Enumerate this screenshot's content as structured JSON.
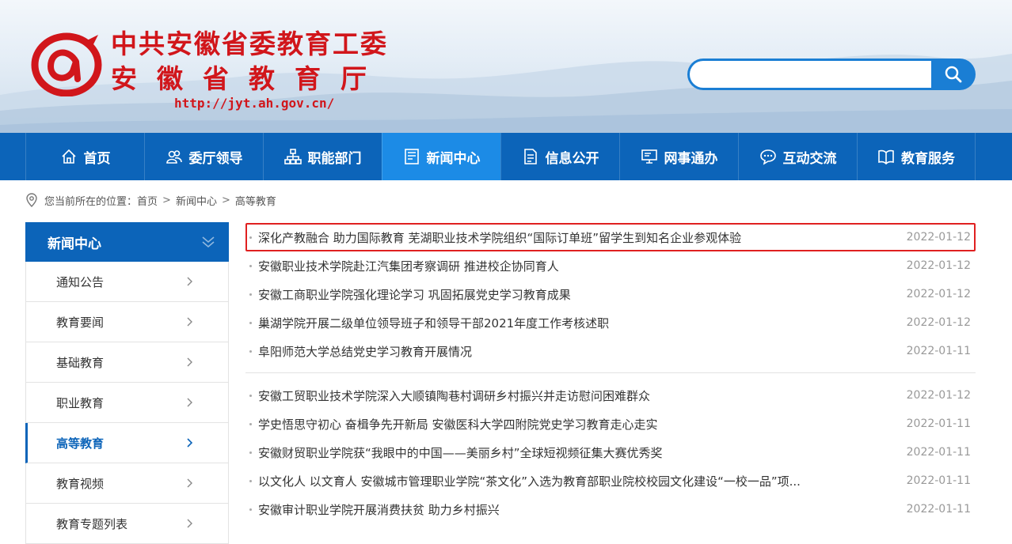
{
  "header": {
    "title_line1": "中共安徽省委教育工委",
    "title_line2": "安徽省教育厅",
    "url": "http://jyt.ah.gov.cn/",
    "brand_color": "#d1161b"
  },
  "search": {
    "placeholder": "",
    "value": "",
    "button_icon": "search-icon"
  },
  "nav": {
    "items": [
      {
        "label": "首页",
        "icon": "home-icon"
      },
      {
        "label": "委厅领导",
        "icon": "users-icon"
      },
      {
        "label": "职能部门",
        "icon": "org-chart-icon"
      },
      {
        "label": "新闻中心",
        "icon": "news-icon",
        "active": true
      },
      {
        "label": "信息公开",
        "icon": "document-icon"
      },
      {
        "label": "网事通办",
        "icon": "computer-icon"
      },
      {
        "label": "互动交流",
        "icon": "chat-icon"
      },
      {
        "label": "教育服务",
        "icon": "book-icon"
      }
    ],
    "color": "#0c64b9",
    "active_color": "#1c8be6"
  },
  "breadcrumb": {
    "prefix": "您当前所在的位置：",
    "items": [
      "首页",
      "新闻中心",
      "高等教育"
    ]
  },
  "sidebar": {
    "heading": "新闻中心",
    "items": [
      {
        "label": "通知公告"
      },
      {
        "label": "教育要闻"
      },
      {
        "label": "基础教育"
      },
      {
        "label": "职业教育"
      },
      {
        "label": "高等教育",
        "active": true
      },
      {
        "label": "教育视频"
      },
      {
        "label": "教育专题列表"
      }
    ]
  },
  "news_group_1": [
    {
      "title": "深化产教融合 助力国际教育 芜湖职业技术学院组织“国际订单班”留学生到知名企业参观体验",
      "date": "2022-01-12"
    },
    {
      "title": "安徽职业技术学院赴江汽集团考察调研 推进校企协同育人",
      "date": "2022-01-12"
    },
    {
      "title": "安徽工商职业学院强化理论学习 巩固拓展党史学习教育成果",
      "date": "2022-01-12"
    },
    {
      "title": "巢湖学院开展二级单位领导班子和领导干部2021年度工作考核述职",
      "date": "2022-01-12"
    },
    {
      "title": "阜阳师范大学总结党史学习教育开展情况",
      "date": "2022-01-11"
    }
  ],
  "news_group_2": [
    {
      "title": "安徽工贸职业技术学院深入大顺镇陶巷村调研乡村振兴并走访慰问困难群众",
      "date": "2022-01-12"
    },
    {
      "title": "学史悟思守初心 奋楫争先开新局 安徽医科大学四附院党史学习教育走心走实",
      "date": "2022-01-11"
    },
    {
      "title": "安徽财贸职业学院获“我眼中的中国——美丽乡村”全球短视频征集大赛优秀奖",
      "date": "2022-01-11"
    },
    {
      "title": "以文化人 以文育人 安徽城市管理职业学院“茶文化”入选为教育部职业院校校园文化建设“一校一品”项...",
      "date": "2022-01-11"
    },
    {
      "title": "安徽审计职业学院开展消费扶贫 助力乡村振兴",
      "date": "2022-01-11"
    }
  ]
}
